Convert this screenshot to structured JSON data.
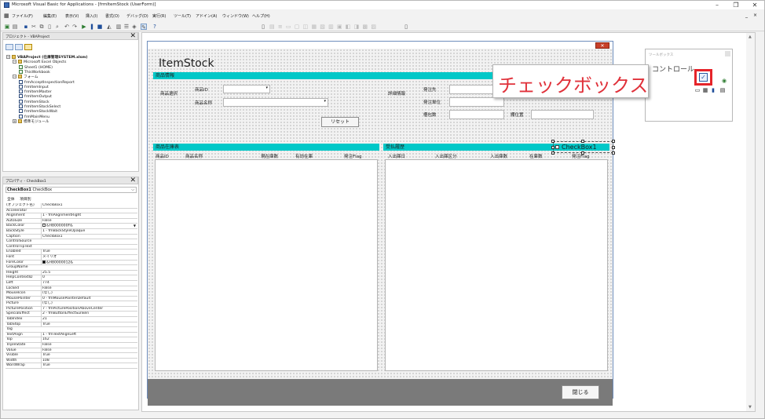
{
  "window": {
    "title": "Microsoft Visual Basic for Applications - [frmItemStock (UserForm)]",
    "controls": [
      "–",
      "❐",
      "✕"
    ],
    "mdi_controls": [
      "_",
      "🗗",
      "×"
    ]
  },
  "menubar": [
    "ファイル(F)",
    "編集(E)",
    "表示(V)",
    "挿入(I)",
    "書式(O)",
    "デバッグ(D)",
    "実行(R)",
    "ツール(T)",
    "アドイン(A)",
    "ウィンドウ(W)",
    "ヘルプ(H)"
  ],
  "project_pane": {
    "title": "プロジェクト - VBAProject",
    "close": "✕",
    "tree": [
      {
        "label": "VBAProject (在庫管理SYSTEM.xlsm)",
        "level": 0,
        "kind": "folder",
        "bold": true,
        "expand": "−"
      },
      {
        "label": "Microsoft Excel Objects",
        "level": 1,
        "kind": "folder",
        "expand": "−"
      },
      {
        "label": "Sheet1 (HOME)",
        "level": 2,
        "kind": "sheet"
      },
      {
        "label": "ThisWorkbook",
        "level": 2,
        "kind": "sheet"
      },
      {
        "label": "フォーム",
        "level": 1,
        "kind": "folder",
        "expand": "−"
      },
      {
        "label": "frmAcceptInspectionReport",
        "level": 2,
        "kind": "form"
      },
      {
        "label": "frmItemInput",
        "level": 2,
        "kind": "form"
      },
      {
        "label": "frmItemMaster",
        "level": 2,
        "kind": "form"
      },
      {
        "label": "frmItemOutput",
        "level": 2,
        "kind": "form"
      },
      {
        "label": "frmItemStock",
        "level": 2,
        "kind": "form"
      },
      {
        "label": "frmItemStockSelect",
        "level": 2,
        "kind": "form"
      },
      {
        "label": "frmItemStockWait",
        "level": 2,
        "kind": "form"
      },
      {
        "label": "frmMainMenu",
        "level": 2,
        "kind": "form"
      },
      {
        "label": "標準モジュール",
        "level": 1,
        "kind": "folder",
        "expand": "+"
      }
    ]
  },
  "props_pane": {
    "title": "プロパティ - CheckBox1",
    "close": "✕",
    "object_name": "CheckBox1",
    "object_type": "CheckBox",
    "tabs": [
      "全体",
      "項目別"
    ],
    "rows": [
      {
        "k": "(オブジェクト名)",
        "v": "CheckBox1"
      },
      {
        "k": "Accelerator",
        "v": ""
      },
      {
        "k": "Alignment",
        "v": "1 - fmAlignmentRight"
      },
      {
        "k": "AutoSize",
        "v": "False"
      },
      {
        "k": "BackColor",
        "v": "&H8000000F&",
        "swatch": "#ffffff",
        "dropdown": true
      },
      {
        "k": "BackStyle",
        "v": "1 - fmBackStyleOpaque"
      },
      {
        "k": "Caption",
        "v": "CheckBox1"
      },
      {
        "k": "ControlSource",
        "v": ""
      },
      {
        "k": "ControlTipText",
        "v": ""
      },
      {
        "k": "Enabled",
        "v": "True"
      },
      {
        "k": "Font",
        "v": "メイリオ"
      },
      {
        "k": "ForeColor",
        "v": "&H80000012&",
        "swatch": "#000000"
      },
      {
        "k": "GroupName",
        "v": ""
      },
      {
        "k": "Height",
        "v": "25.5"
      },
      {
        "k": "HelpContextID",
        "v": "0"
      },
      {
        "k": "Left",
        "v": "774"
      },
      {
        "k": "Locked",
        "v": "False"
      },
      {
        "k": "MouseIcon",
        "v": "(なし)"
      },
      {
        "k": "MousePointer",
        "v": "0 - fmMousePointerDefault"
      },
      {
        "k": "Picture",
        "v": "(なし)"
      },
      {
        "k": "PicturePosition",
        "v": "7 - fmPicturePositionAboveCenter"
      },
      {
        "k": "SpecialEffect",
        "v": "2 - fmButtonEffectSunken"
      },
      {
        "k": "TabIndex",
        "v": "21"
      },
      {
        "k": "TabStop",
        "v": "True"
      },
      {
        "k": "Tag",
        "v": ""
      },
      {
        "k": "TextAlign",
        "v": "1 - fmTextAlignLeft"
      },
      {
        "k": "Top",
        "v": "162"
      },
      {
        "k": "TripleState",
        "v": "False"
      },
      {
        "k": "Value",
        "v": "False"
      },
      {
        "k": "Visible",
        "v": "True"
      },
      {
        "k": "Width",
        "v": "108"
      },
      {
        "k": "WordWrap",
        "v": "True"
      }
    ]
  },
  "userform": {
    "title": "ItemStock",
    "close": "✕",
    "product_info": {
      "header": "商品情報",
      "select_label": "商品選択",
      "id_label": "商品ID",
      "name_label": "商品名称",
      "reset_button": "リセット"
    },
    "detail_info": {
      "label": "詳細情報",
      "supplier": "発注先",
      "order_unit": "発注単位",
      "box_count": "梱包数",
      "location": "棚位置"
    },
    "stock_list": {
      "header": "商品在庫表",
      "columns": [
        "商品ID",
        "商品名称",
        "現在庫数",
        "有効在庫",
        "発注Flag"
      ]
    },
    "history_list": {
      "header": "受払履歴",
      "columns": [
        "入出庫日",
        "入出庫区分",
        "入出庫数",
        "在庫数",
        "発注Flag"
      ]
    },
    "checkbox_caption": "CheckBox1",
    "close_button": "閉じる"
  },
  "toolbox": {
    "title": "ツールボックス",
    "ctrl_label": "コントロール"
  },
  "callout": {
    "text": "チェックボックス"
  },
  "colors": {
    "section_header": "#00c8c8",
    "callout_text": "#e0313a",
    "highlight": "#e5242a"
  }
}
